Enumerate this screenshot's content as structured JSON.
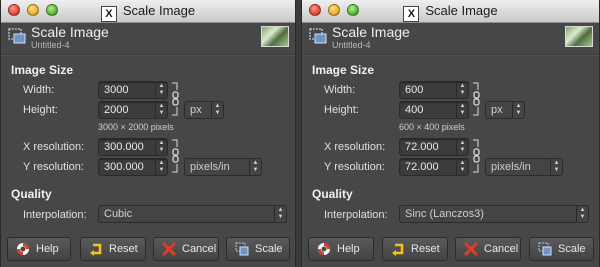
{
  "dialogs": [
    {
      "window_title": "Scale Image",
      "x11_badge": "X",
      "header": {
        "title": "Scale Image",
        "subtitle": "Untitled-4"
      },
      "image_size": {
        "section": "Image Size",
        "width_label": "Width:",
        "width_value": "3000",
        "height_label": "Height:",
        "height_value": "2000",
        "unit": "px",
        "pixel_info": "3000 × 2000 pixels",
        "xres_label": "X resolution:",
        "xres_value": "300.000",
        "yres_label": "Y resolution:",
        "yres_value": "300.000",
        "res_unit": "pixels/in"
      },
      "quality": {
        "section": "Quality",
        "interp_label": "Interpolation:",
        "interp_value": "Cubic"
      },
      "buttons": {
        "help": "Help",
        "reset": "Reset",
        "cancel": "Cancel",
        "scale": "Scale"
      }
    },
    {
      "window_title": "Scale Image",
      "x11_badge": "X",
      "header": {
        "title": "Scale Image",
        "subtitle": "Untitled-4"
      },
      "image_size": {
        "section": "Image Size",
        "width_label": "Width:",
        "width_value": "600",
        "height_label": "Height:",
        "height_value": "400",
        "unit": "px",
        "pixel_info": "600 × 400 pixels",
        "xres_label": "X resolution:",
        "xres_value": "72.000",
        "yres_label": "Y resolution:",
        "yres_value": "72.000",
        "res_unit": "pixels/in"
      },
      "quality": {
        "section": "Quality",
        "interp_label": "Interpolation:",
        "interp_value": "Sinc (Lanczos3)"
      },
      "buttons": {
        "help": "Help",
        "reset": "Reset",
        "cancel": "Cancel",
        "scale": "Scale"
      }
    }
  ],
  "icons": {
    "close": "traffic-light-close-icon",
    "minimize": "traffic-light-minimize-icon",
    "maximize": "traffic-light-maximize-icon",
    "scale": "scale-image-icon",
    "chain": "chain-link-icon",
    "help": "lifebuoy-icon",
    "reset": "reset-arrow-icon",
    "cancel": "cancel-x-icon"
  }
}
